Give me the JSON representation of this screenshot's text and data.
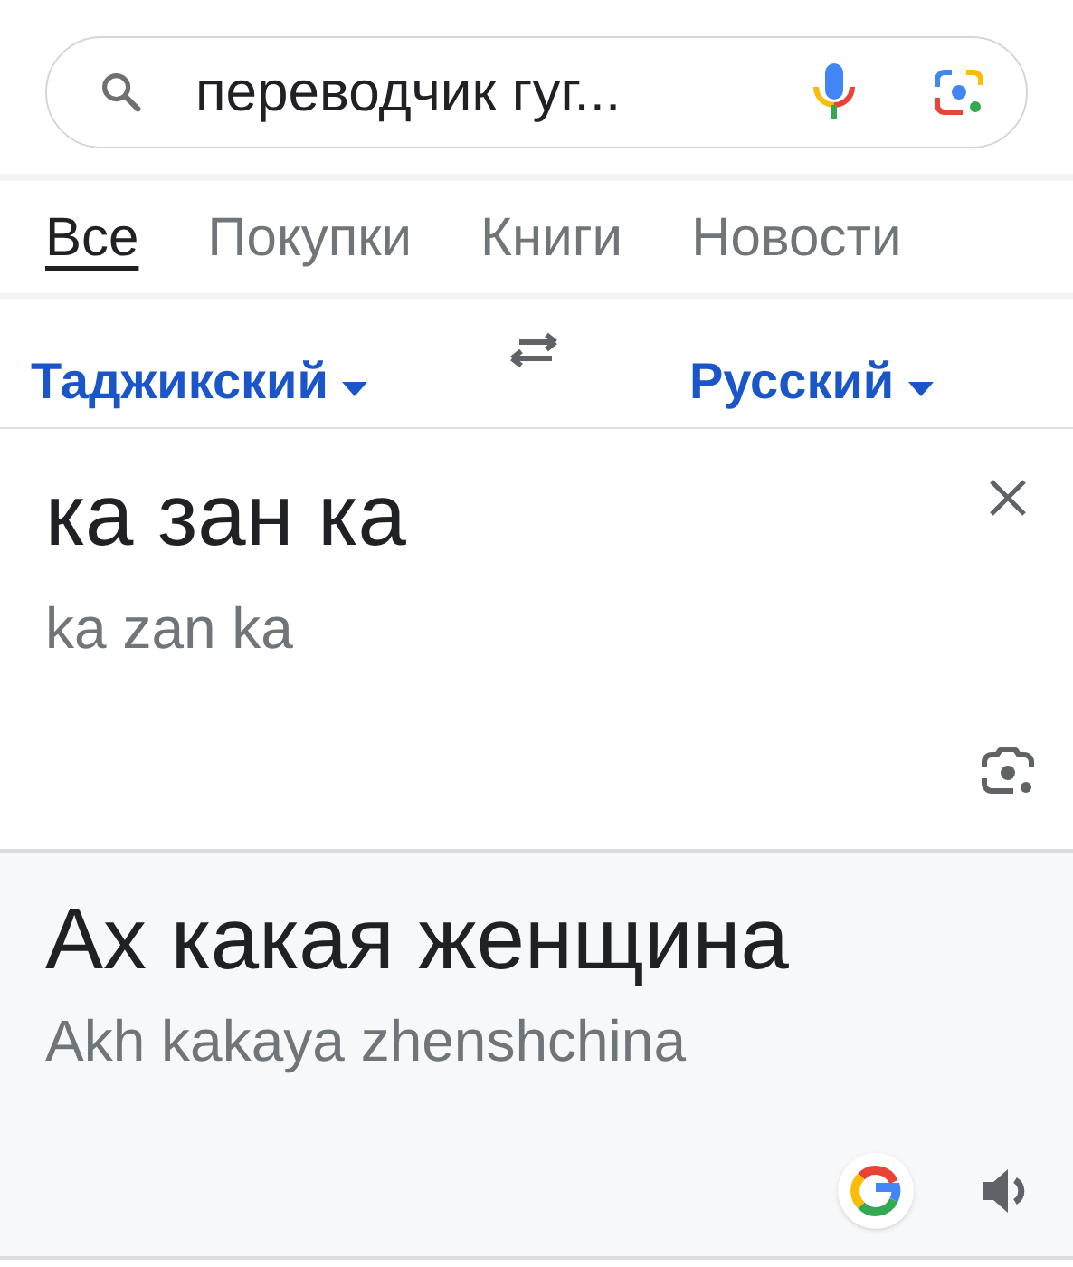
{
  "search": {
    "value": "переводчик гуг..."
  },
  "tabs": [
    {
      "label": "Все",
      "selected": true
    },
    {
      "label": "Покупки",
      "selected": false
    },
    {
      "label": "Книги",
      "selected": false
    },
    {
      "label": "Новости",
      "selected": false
    }
  ],
  "translator": {
    "source_language": "Таджикский",
    "target_language": "Русский",
    "input": "ка зан ка",
    "input_transliteration": "ka zan ka",
    "output": "Ах какая женщина",
    "output_transliteration": "Akh kakaya zhenshchina"
  }
}
